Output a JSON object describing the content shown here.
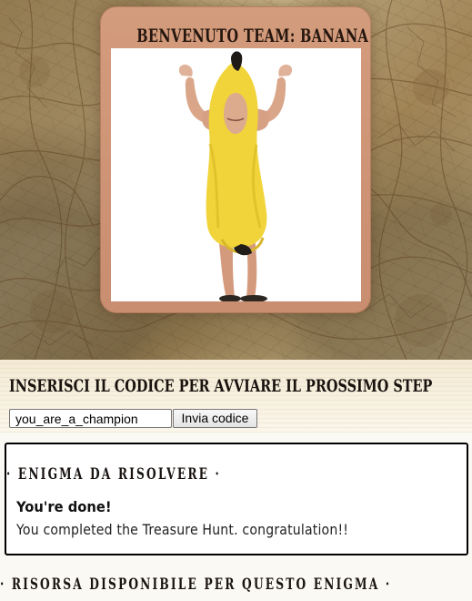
{
  "team": {
    "welcome_title": "BENVENUTO TEAM: BANANA",
    "image_subject": "person in banana costume flexing arms"
  },
  "next_step": {
    "title": "INSERISCI IL CODICE PER AVVIARE IL PROSSIMO STEP",
    "code_value": "you_are_a_champion",
    "submit_label": "Invia codice"
  },
  "riddle": {
    "heading": "· ENIGMA DA RISOLVERE ·",
    "completion_title": "You're done!",
    "completion_message": "You completed the Treasure Hunt. congratulation!!"
  },
  "resource": {
    "heading": "· RISORSA DISPONIBILE PER QUESTO ENIGMA ·"
  },
  "colors": {
    "map_background": "#d2b987",
    "frame": "#cd9678",
    "banana_yellow": "#f1d43a",
    "border": "#000000"
  }
}
